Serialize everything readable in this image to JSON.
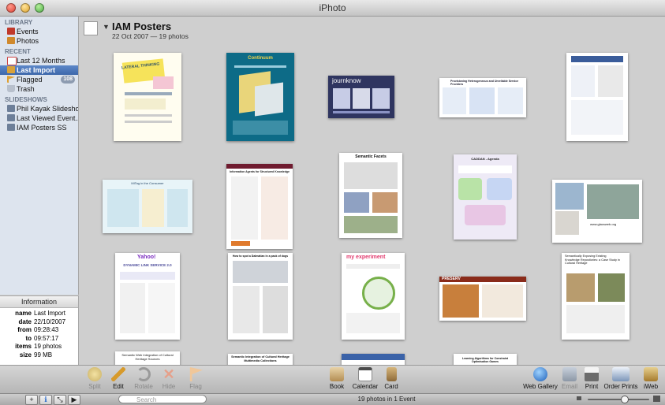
{
  "window": {
    "title": "iPhoto"
  },
  "sidebar": {
    "library_label": "LIBRARY",
    "library": [
      {
        "label": "Events",
        "icon": "events-icon",
        "color": "#c0392b"
      },
      {
        "label": "Photos",
        "icon": "photos-icon",
        "color": "#d0892c"
      }
    ],
    "recent_label": "RECENT",
    "recent": [
      {
        "label": "Last 12 Months",
        "icon": "calendar-icon",
        "color": "#e26b4a"
      },
      {
        "label": "Last Import",
        "icon": "import-icon",
        "color": "#d9a23a",
        "selected": true
      },
      {
        "label": "Flagged",
        "icon": "flag-icon",
        "color": "#e0a030",
        "badge": "108"
      },
      {
        "label": "Trash",
        "icon": "trash-icon",
        "color": "#9aa4b2"
      }
    ],
    "slideshows_label": "SLIDESHOWS",
    "slideshows": [
      {
        "label": "Phil Kayak Slideshow",
        "icon": "slideshow-icon"
      },
      {
        "label": "Last Viewed Event...",
        "icon": "slideshow-icon"
      },
      {
        "label": "IAM Posters SS",
        "icon": "slideshow-icon"
      }
    ]
  },
  "info": {
    "header": "Information",
    "rows": [
      {
        "k": "name",
        "v": "Last Import"
      },
      {
        "k": "date",
        "v": "22/10/2007"
      },
      {
        "k": "from",
        "v": "09:28:43"
      },
      {
        "k": "to",
        "v": "09:57:17"
      },
      {
        "k": "items",
        "v": "19 photos"
      },
      {
        "k": "size",
        "v": "99 MB"
      }
    ]
  },
  "event": {
    "title": "IAM Posters",
    "subtitle": "22 Oct 2007 — 19 photos"
  },
  "posters": {
    "p1": "LATERAL THINKING",
    "p2": "Continuum",
    "p3": "journknow",
    "p4": "Provisioning Heterogeneous and Unreliable Service Providers",
    "p6": "MiTag in the Consumer",
    "p7": "Information Agents for Structured Knowledge",
    "p8": "Semantic Facets",
    "p9": "CADDAN - Agenda",
    "p10": "www.glacsweb.org",
    "p11": "DYNAMIC LINK SERVICE 2.0",
    "p11b": "Yahoo!",
    "p12": "How to spot a Dalmatian in a pack of dogs",
    "p13": "my experiment",
    "p14": "PRESERV",
    "p15": "Semantically Exposing Existing Knowledge Repositories: a Case Study in Cultural Heritage",
    "p16": "Semantic Web Integration of Cultural Heritage Sources",
    "p17": "Semantic Integration of Cultural Heritage Multimedia Collections",
    "p19": "Learning Algorithms for Constraint Optimisation Games"
  },
  "toolbar": {
    "left": [
      {
        "label": "Split",
        "enabled": false
      },
      {
        "label": "Edit",
        "enabled": true
      },
      {
        "label": "Rotate",
        "enabled": false
      },
      {
        "label": "Hide",
        "enabled": false
      },
      {
        "label": "Flag",
        "enabled": false
      }
    ],
    "center": [
      {
        "label": "Book"
      },
      {
        "label": "Calendar"
      },
      {
        "label": "Card"
      }
    ],
    "right": [
      {
        "label": "Web Gallery",
        "enabled": true
      },
      {
        "label": "Email",
        "enabled": false
      },
      {
        "label": "Print",
        "enabled": true
      },
      {
        "label": "Order Prints",
        "enabled": true
      },
      {
        "label": "iWeb",
        "enabled": true
      }
    ]
  },
  "statusbar": {
    "search_placeholder": "Search",
    "status": "19 photos in 1 Event",
    "zoom_level": 0.6
  }
}
